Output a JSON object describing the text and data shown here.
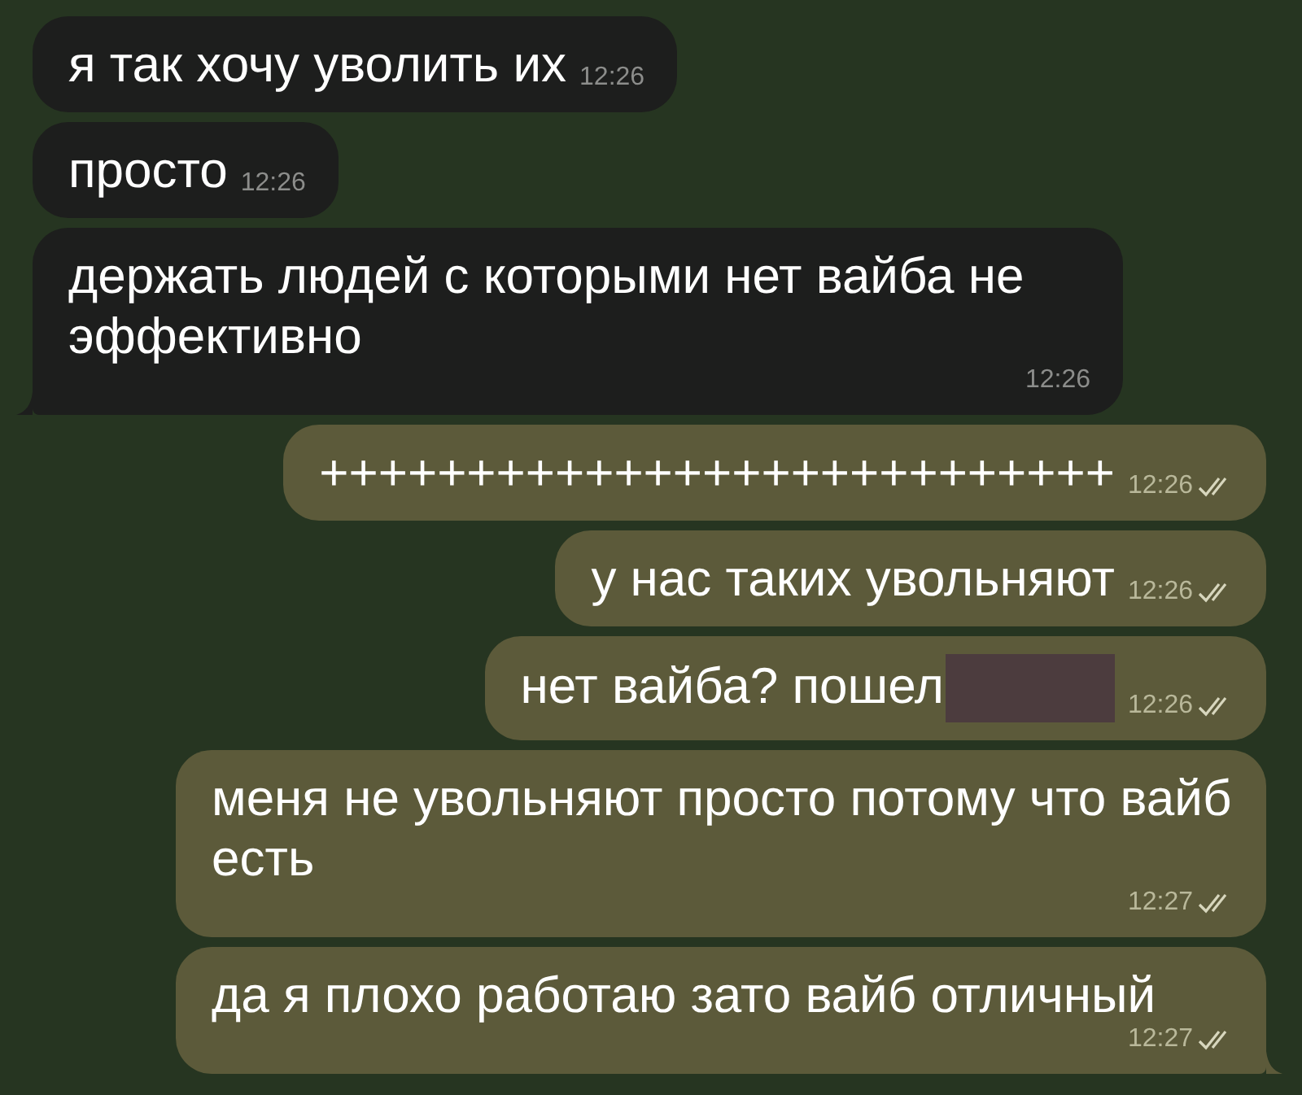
{
  "messages": [
    {
      "kind": "incoming",
      "text": "я так хочу уволить их",
      "time": "12:26",
      "tail": false
    },
    {
      "kind": "incoming",
      "text": "просто",
      "time": "12:26",
      "tail": false
    },
    {
      "kind": "incoming",
      "text": "держать людей с которыми нет вайба не эффективно",
      "time": "12:26",
      "tail": true
    },
    {
      "kind": "outgoing",
      "text": "+++++++++++++++++++++++++++",
      "time": "12:26",
      "read": true,
      "tail": false
    },
    {
      "kind": "outgoing",
      "text": "у нас таких увольняют",
      "time": "12:26",
      "read": true,
      "tail": false
    },
    {
      "kind": "outgoing",
      "text": "нет вайба? пошел",
      "time": "12:26",
      "read": true,
      "tail": false,
      "redacted": true
    },
    {
      "kind": "outgoing",
      "text": "меня не увольняют просто потому что вайб есть",
      "time": "12:27",
      "read": true,
      "tail": false
    },
    {
      "kind": "outgoing",
      "text": "да я плохо работаю зато вайб отличный",
      "time": "12:27",
      "read": true,
      "tail": true
    }
  ]
}
